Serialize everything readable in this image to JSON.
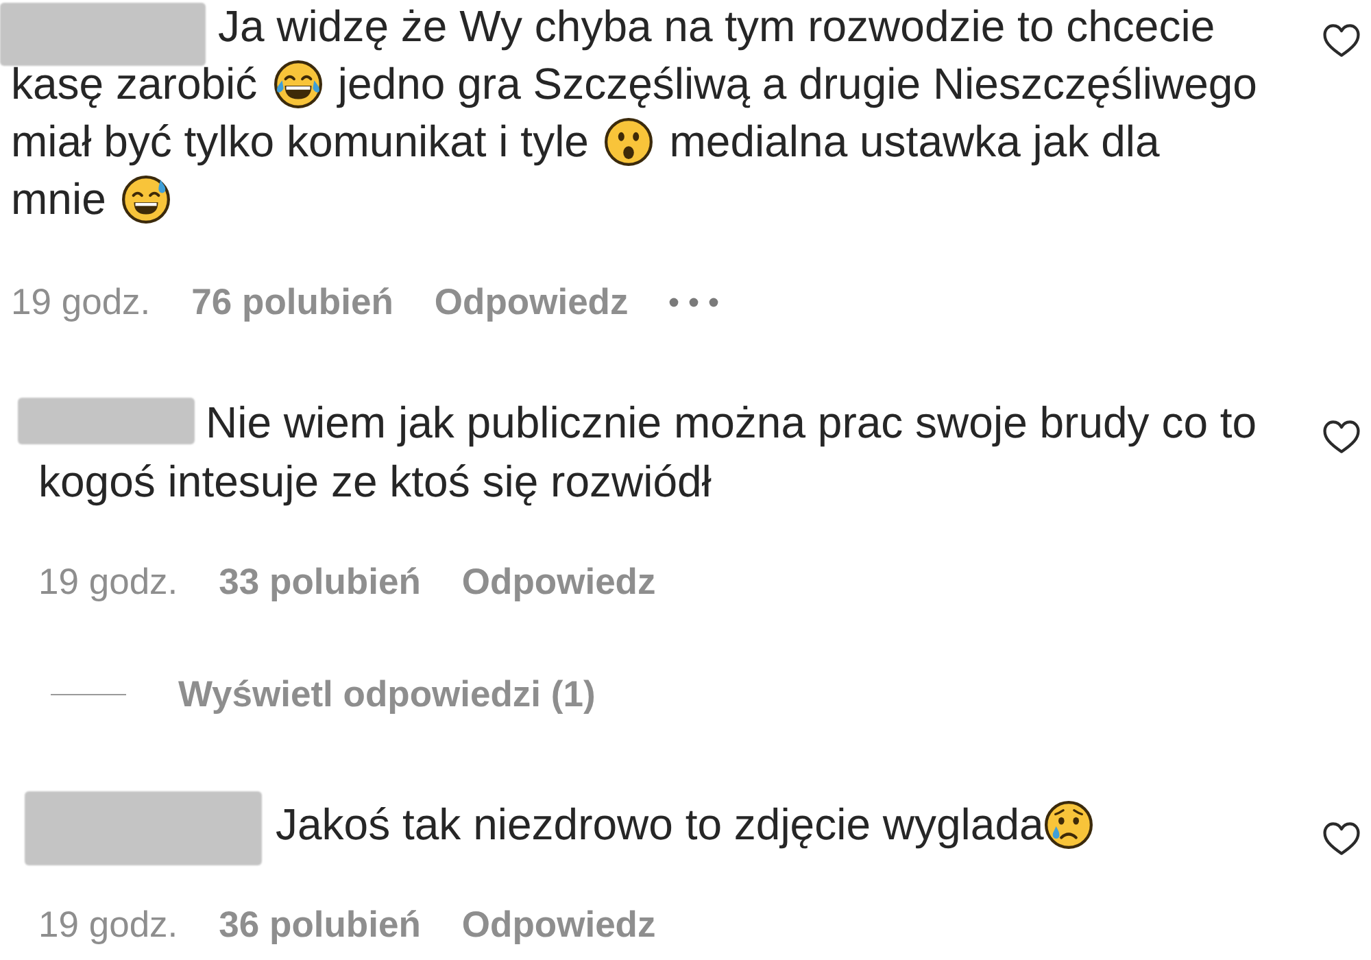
{
  "comments": [
    {
      "lines": [
        [
          {
            "kind": "text",
            "text": "Ja widzę że Wy chyba na tym rozwodzie to chcecie"
          }
        ],
        [
          {
            "kind": "text",
            "text": "kasę zarobić "
          },
          {
            "kind": "laughing"
          },
          {
            "kind": "text",
            "text": " jedno gra Szczęśliwą a drugie Nieszczęśliwego"
          }
        ],
        [
          {
            "kind": "text",
            "text": "miał być tylko komunikat i tyle "
          },
          {
            "kind": "astonished"
          },
          {
            "kind": "text",
            "text": " medialna ustawka jak dla"
          }
        ],
        [
          {
            "kind": "text",
            "text": "mnie "
          },
          {
            "kind": "sweating"
          }
        ]
      ],
      "liked": false,
      "time": "19 godz.",
      "likes": "76 polubień",
      "reply": "Odpowiedz",
      "more_options": true
    },
    {
      "lines": [
        [
          {
            "kind": "text",
            "text": "Nie wiem jak publicznie można prac swoje brudy co to"
          }
        ],
        [
          {
            "kind": "text",
            "text": "kogoś intesuje ze ktoś się rozwiódł"
          }
        ]
      ],
      "liked": false,
      "time": "19 godz.",
      "likes": "33 polubień",
      "reply": "Odpowiedz",
      "more_options": false,
      "replies_link": "Wyświetl odpowiedzi (1)"
    },
    {
      "lines": [
        [
          {
            "kind": "text",
            "text": "Jakoś tak niezdrowo to zdjęcie wyglada"
          },
          {
            "kind": "crying"
          }
        ]
      ],
      "liked": false,
      "time": "19 godz.",
      "likes": "36 polubień",
      "reply": "Odpowiedz",
      "more_options": false
    }
  ]
}
